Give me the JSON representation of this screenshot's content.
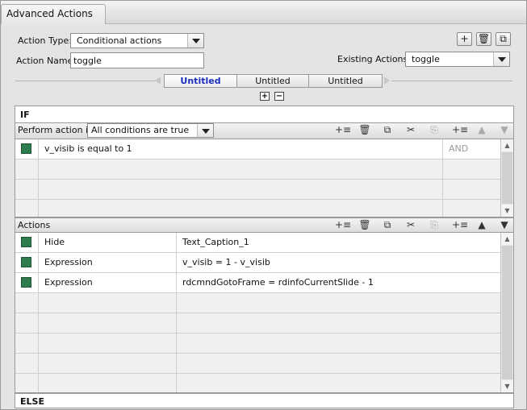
{
  "window": {
    "title": "Advanced Actions"
  },
  "form": {
    "action_type_label": "Action Type:",
    "action_type_value": "Conditional actions",
    "action_name_label": "Action Name:",
    "action_name_value": "toggle",
    "existing_actions_label": "Existing Actions:",
    "existing_actions_value": "toggle"
  },
  "toolbar": {
    "add": "+",
    "delete": "🗑",
    "duplicate": "⧉"
  },
  "tabs": [
    {
      "label": "Untitled",
      "active": true
    },
    {
      "label": "Untitled",
      "active": false
    },
    {
      "label": "Untitled",
      "active": false
    }
  ],
  "mini_buttons": {
    "add": "+",
    "remove": "−"
  },
  "if_section": {
    "header": "IF",
    "perform_label": "Perform action if:",
    "perform_value": "All conditions are true",
    "conditions": [
      {
        "c1": "v_visib   is equal to    1",
        "op": "AND"
      }
    ]
  },
  "actions_section": {
    "header": "Actions",
    "rows": [
      {
        "action": "Hide",
        "target": "Text_Caption_1"
      },
      {
        "action": "Expression",
        "target": "v_visib   =   1   -   v_visib"
      },
      {
        "action": "Expression",
        "target": "rdcmndGotoFrame   =   rdinfoCurrentSlide   -   1"
      }
    ]
  },
  "else_section": {
    "header": "ELSE"
  },
  "colors": {
    "checkbox": "#2e7b4e",
    "active_tab": "#1a2ec0"
  }
}
